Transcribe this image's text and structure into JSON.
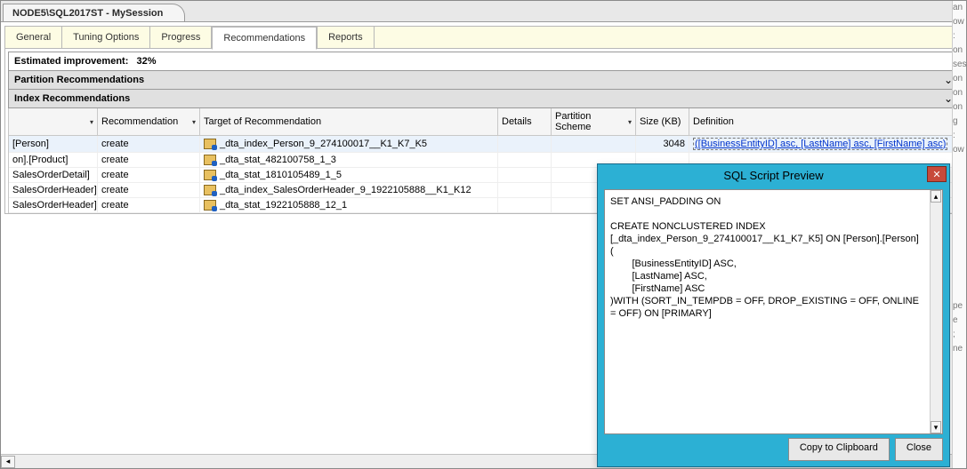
{
  "session_tab": "NODE5\\SQL2017ST - MySession",
  "tabs": {
    "general": "General",
    "tuning": "Tuning Options",
    "progress": "Progress",
    "recommendations": "Recommendations",
    "reports": "Reports"
  },
  "improvement": {
    "label": "Estimated improvement:",
    "value": "32%"
  },
  "sections": {
    "partition": "Partition Recommendations",
    "index": "Index Recommendations"
  },
  "columns": {
    "c0": "",
    "c1": "Recommendation",
    "c2": "Target of Recommendation",
    "c3": "Details",
    "c4": "Partition Scheme",
    "c5": "Size (KB)",
    "c6": "Definition"
  },
  "rows": [
    {
      "obj": "[Person]",
      "rec": "create",
      "target": "_dta_index_Person_9_274100017__K1_K7_K5",
      "size": "3048",
      "def": "([BusinessEntityID] asc, [LastName] asc, [FirstName] asc)",
      "hl": true
    },
    {
      "obj": "on].[Product]",
      "rec": "create",
      "target": "_dta_stat_482100758_1_3",
      "size": "",
      "def": ""
    },
    {
      "obj": "SalesOrderDetail]",
      "rec": "create",
      "target": "_dta_stat_1810105489_1_5",
      "size": "",
      "def": ""
    },
    {
      "obj": "SalesOrderHeader]",
      "rec": "create",
      "target": "_dta_index_SalesOrderHeader_9_1922105888__K1_K12",
      "size": "",
      "def": ""
    },
    {
      "obj": "SalesOrderHeader]",
      "rec": "create",
      "target": "_dta_stat_1922105888_12_1",
      "size": "",
      "def": ""
    }
  ],
  "dialog": {
    "title": "SQL Script Preview",
    "script": "SET ANSI_PADDING ON\n\nCREATE NONCLUSTERED INDEX\n[_dta_index_Person_9_274100017__K1_K7_K5] ON [Person].[Person]\n(\n\t[BusinessEntityID] ASC,\n\t[LastName] ASC,\n\t[FirstName] ASC\n)WITH (SORT_IN_TEMPDB = OFF, DROP_EXISTING = OFF, ONLINE = OFF) ON [PRIMARY]",
    "copy": "Copy to Clipboard",
    "close": "Close"
  },
  "gutter_text": "an\now\n:\non\nses\non\non\non\ng\n:\now\n\n\n\n\n\n\n\n\n\n\npe\ne\n;\nne\n"
}
